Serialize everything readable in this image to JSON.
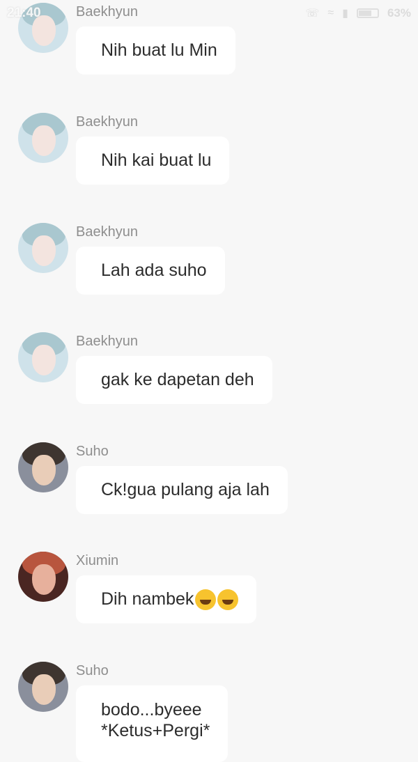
{
  "status_bar": {
    "time": "21:40",
    "battery_percent": "63%",
    "battery_level": 0.63
  },
  "messages": [
    {
      "sender": "Baekhyun",
      "text": "Nih buat lu Min"
    },
    {
      "sender": "Baekhyun",
      "text": "Nih kai buat lu"
    },
    {
      "sender": "Baekhyun",
      "text": "Lah ada suho"
    },
    {
      "sender": "Baekhyun",
      "text": "gak ke dapetan deh"
    },
    {
      "sender": "Suho",
      "text": "Ck!gua pulang aja lah"
    },
    {
      "sender": "Xiumin",
      "text": "Dih nambek",
      "emojis": [
        "laughing-emoji",
        "rolling-on-floor-laughing-emoji"
      ]
    },
    {
      "sender": "Suho",
      "text_line1": "bodo...byeee",
      "text_line2": "*Ketus+Pergi*"
    }
  ]
}
